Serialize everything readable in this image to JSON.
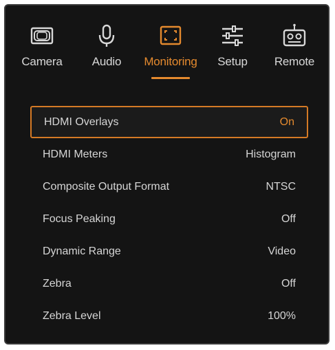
{
  "tabs": [
    {
      "label": "Camera",
      "icon": "camera-icon",
      "active": false
    },
    {
      "label": "Audio",
      "icon": "microphone-icon",
      "active": false
    },
    {
      "label": "Monitoring",
      "icon": "monitor-frame-icon",
      "active": true
    },
    {
      "label": "Setup",
      "icon": "sliders-icon",
      "active": false
    },
    {
      "label": "Remote",
      "icon": "remote-control-icon",
      "active": false
    }
  ],
  "settings": [
    {
      "name": "HDMI Overlays",
      "value": "On",
      "selected": true
    },
    {
      "name": "HDMI Meters",
      "value": "Histogram",
      "selected": false
    },
    {
      "name": "Composite Output Format",
      "value": "NTSC",
      "selected": false
    },
    {
      "name": "Focus Peaking",
      "value": "Off",
      "selected": false
    },
    {
      "name": "Dynamic Range",
      "value": "Video",
      "selected": false
    },
    {
      "name": "Zebra",
      "value": "Off",
      "selected": false
    },
    {
      "name": "Zebra Level",
      "value": "100%",
      "selected": false
    }
  ],
  "colors": {
    "accent": "#e58a2e",
    "background": "#141414",
    "text": "#d6d6d6"
  }
}
